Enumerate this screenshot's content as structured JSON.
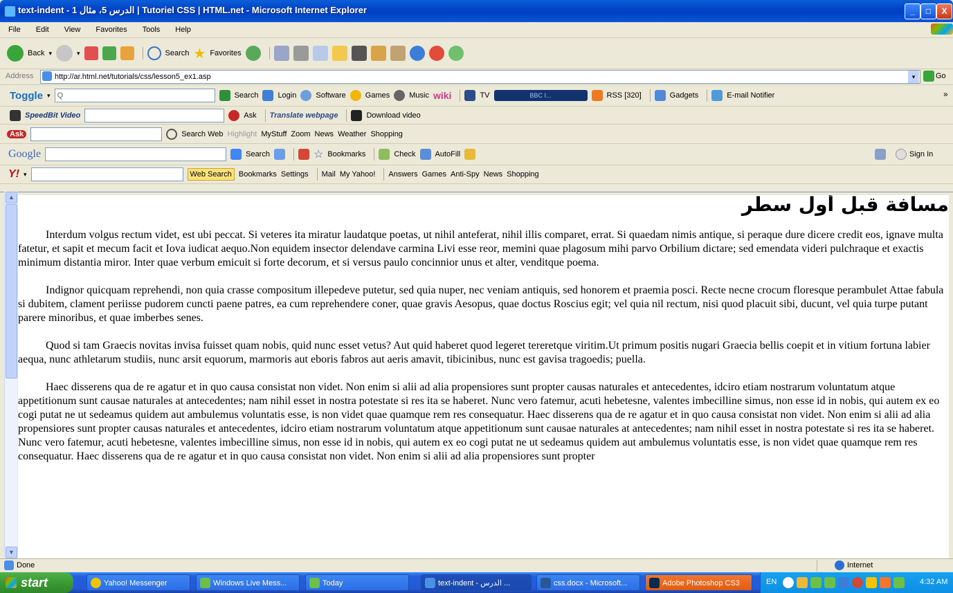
{
  "window": {
    "title": "text-indent - الدرس 5، مثال 1 | Tutoriel CSS | HTML.net - Microsoft Internet Explorer",
    "minimize": "_",
    "maximize": "□",
    "close": "X"
  },
  "menu": [
    "File",
    "Edit",
    "View",
    "Favorites",
    "Tools",
    "Help"
  ],
  "standard_toolbar": {
    "back": "Back",
    "search": "Search",
    "favorites": "Favorites"
  },
  "address": {
    "label": "Address",
    "url": "http://ar.html.net/tutorials/css/lesson5_ex1.asp",
    "go": "Go"
  },
  "toggle_bar": {
    "brand": "Toggle",
    "search_prefix": "Q",
    "items": [
      "Search",
      "Login",
      "Software",
      "Games",
      "Music",
      "wiki",
      "TV",
      "BBC I...",
      "RSS [320]",
      "Gadgets",
      "E-mail Notifier"
    ],
    "overflow": "»"
  },
  "speedbit_bar": {
    "brand": "SpeedBit Video",
    "ask": "Ask",
    "translate": "Translate webpage",
    "download": "Download video"
  },
  "ask_bar": {
    "brand": "Ask",
    "items": [
      "Search Web",
      "Highlight",
      "MyStuff",
      "Zoom",
      "News",
      "Weather",
      "Shopping"
    ]
  },
  "google_bar": {
    "brand": "Google",
    "items": [
      "Search",
      "Bookmarks",
      "Check",
      "AutoFill"
    ],
    "sign_in": "Sign In"
  },
  "yahoo_bar": {
    "brand": "Y!",
    "web_search": "Web Search",
    "items": [
      "Bookmarks",
      "Settings",
      "Mail",
      "My Yahoo!",
      "Answers",
      "Games",
      "Anti-Spy",
      "News",
      "Shopping"
    ]
  },
  "page": {
    "heading": "مسافة قبل أول سطر",
    "paragraphs": [
      "Interdum volgus rectum videt, est ubi peccat. Si veteres ita miratur laudatque poetas, ut nihil anteferat, nihil illis comparet, errat. Si quaedam nimis antique, si peraque dure dicere credit eos, ignave multa fatetur, et sapit et mecum facit et Iova iudicat aequo.Non equidem insector delendave carmina Livi esse reor, memini quae plagosum mihi parvo Orbilium dictare; sed emendata videri pulchraque et exactis minimum distantia miror. Inter quae verbum emicuit si forte decorum, et si versus paulo concinnior unus et alter, venditque poema.",
      "Indignor quicquam reprehendi, non quia crasse compositum illepedeve putetur, sed quia nuper, nec veniam antiquis, sed honorem et praemia posci. Recte necne crocum floresque perambulet Attae fabula si dubitem, clament periisse pudorem cuncti paene patres, ea cum reprehendere coner, quae gravis Aesopus, quae doctus Roscius egit; vel quia nil rectum, nisi quod placuit sibi, ducunt, vel quia turpe putant parere minoribus, et quae imberbes senes.",
      "Quod si tam Graecis novitas invisa fuisset quam nobis, quid nunc esset vetus? Aut quid haberet quod legeret tereretque viritim.Ut primum positis nugari Graecia bellis coepit et in vitium fortuna labier aequa, nunc athletarum studiis, nunc arsit equorum, marmoris aut eboris fabros aut aeris amavit, tibicinibus, nunc est gavisa tragoedis; puella.",
      "Haec disserens qua de re agatur et in quo causa consistat non videt. Non enim si alii ad alia propensiores sunt propter causas naturales et antecedentes, idciro etiam nostrarum voluntatum atque appetitionum sunt causae naturales at antecedentes; nam nihil esset in nostra potestate si res ita se haberet. Nunc vero fatemur, acuti hebetesne, valentes imbecilline simus, non esse id in nobis, qui autem ex eo cogi putat ne ut sedeamus quidem aut ambulemus voluntatis esse, is non videt quae quamque rem res consequatur. Haec disserens qua de re agatur et in quo causa consistat non videt. Non enim si alii ad alia propensiores sunt propter causas naturales et antecedentes, idciro etiam nostrarum voluntatum atque appetitionum sunt causae naturales at antecedentes; nam nihil esset in nostra potestate si res ita se haberet. Nunc vero fatemur, acuti hebetesne, valentes imbecilline simus, non esse id in nobis, qui autem ex eo cogi putat ne ut sedeamus quidem aut ambulemus voluntatis esse, is non videt quae quamque rem res consequatur. Haec disserens qua de re agatur et in quo causa consistat non videt. Non enim si alii ad alia propensiores sunt propter"
    ]
  },
  "status": {
    "text": "Done",
    "zone": "Internet"
  },
  "taskbar": {
    "start": "start",
    "tasks": [
      "Yahoo! Messenger",
      "Windows Live Mess...",
      "Today",
      "text-indent - الدرس ...",
      "css.docx - Microsoft...",
      "Adobe Photoshop CS3"
    ],
    "lang": "EN",
    "clock": "4:32 AM"
  },
  "colors": {
    "titlebar": "#0343c6",
    "chrome": "#ece9d8",
    "taskbar": "#245edb",
    "start": "#3a9a33"
  }
}
